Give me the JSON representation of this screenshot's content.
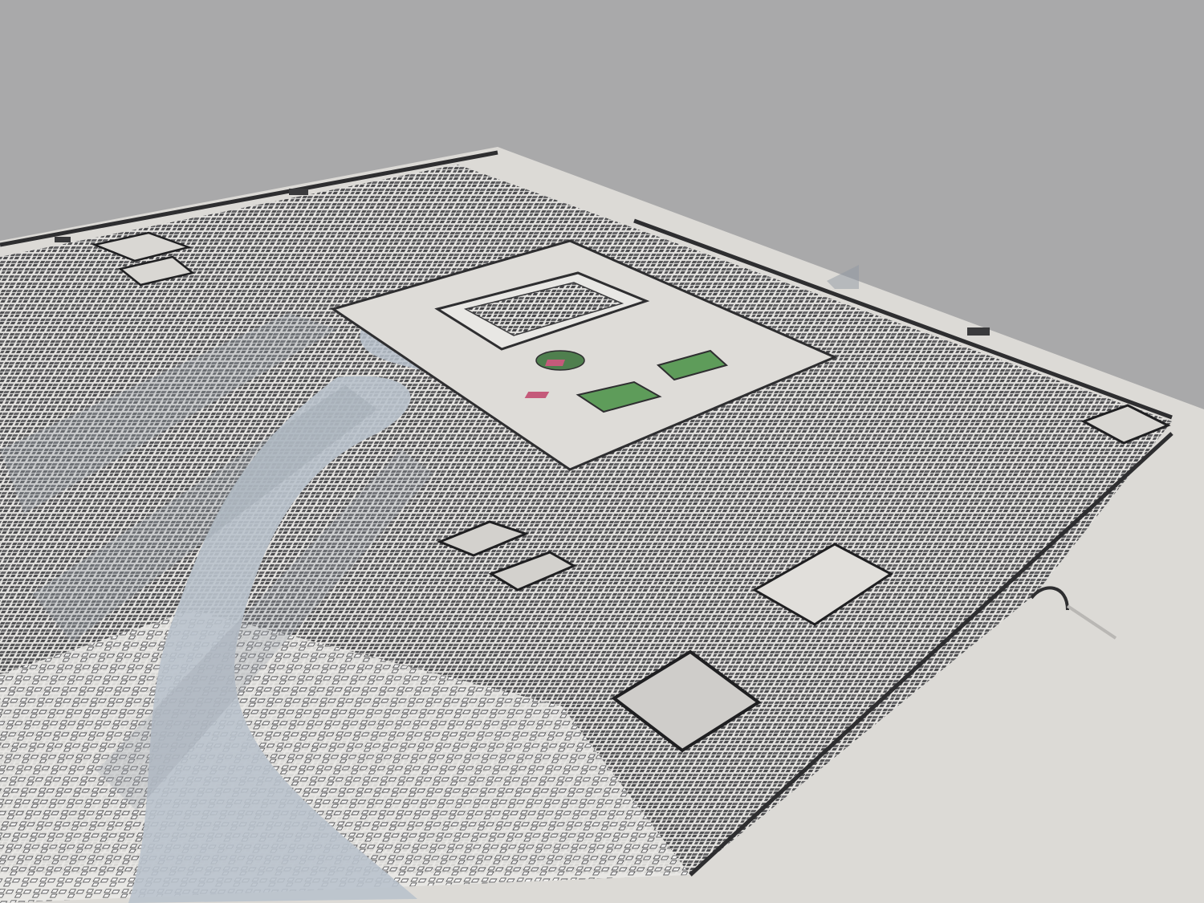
{
  "scene": {
    "kind": "3d-render-city-model",
    "background_color": "#a9a9aa",
    "ground_color": "#dcdad6",
    "river_color": "#b9c2cc",
    "shadow_color": "#9aa2ad",
    "building_fill": "#efeeeb",
    "building_dark": "#3a3a3c",
    "wall_color": "#2e2e30",
    "lawn_color": "#5e9c5a",
    "temple_accent": "#c45a7a",
    "pond_color": "#4f7f4e"
  },
  "caption": ""
}
